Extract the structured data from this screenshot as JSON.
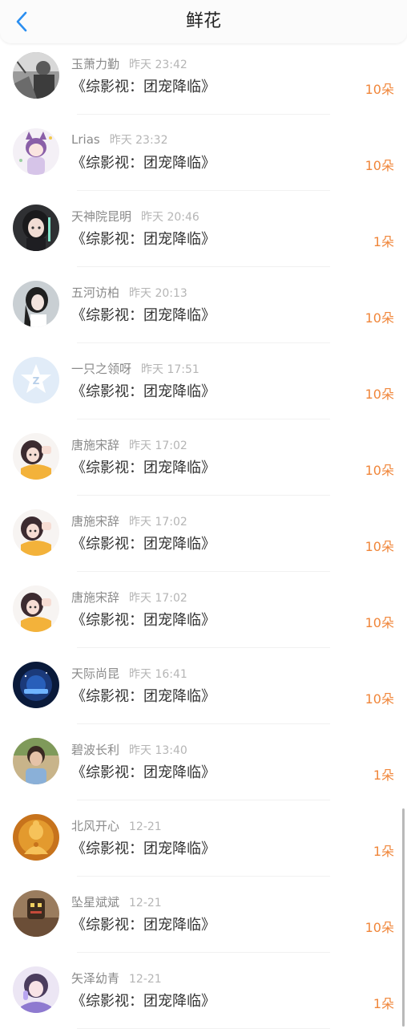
{
  "header": {
    "title": "鲜花",
    "back_icon": "chevron-left-icon",
    "accent_color": "#2a8ef0"
  },
  "flower_color": "#f0863a",
  "records": [
    {
      "name": "玉萧力勤",
      "time": "昨天 23:42",
      "book": "《综影视：团宠降临》",
      "flowers": "10朵",
      "avatar": "avatar-grayscale-photo"
    },
    {
      "name": "Lrias",
      "time": "昨天 23:32",
      "book": "《综影视：团宠降临》",
      "flowers": "10朵",
      "avatar": "avatar-cat-girl"
    },
    {
      "name": "天神院昆明",
      "time": "昨天 20:46",
      "book": "《综影视：团宠降临》",
      "flowers": "1朵",
      "avatar": "avatar-dark-girl"
    },
    {
      "name": "五河访柏",
      "time": "昨天 20:13",
      "book": "《综影视：团宠降临》",
      "flowers": "10朵",
      "avatar": "avatar-long-hair"
    },
    {
      "name": "一只之领呀",
      "time": "昨天 17:51",
      "book": "《综影视：团宠降临》",
      "flowers": "10朵",
      "avatar": "avatar-default-z"
    },
    {
      "name": "唐施宋辞",
      "time": "昨天 17:02",
      "book": "《综影视：团宠降临》",
      "flowers": "10朵",
      "avatar": "avatar-girl-yellow"
    },
    {
      "name": "唐施宋辞",
      "time": "昨天 17:02",
      "book": "《综影视：团宠降临》",
      "flowers": "10朵",
      "avatar": "avatar-girl-yellow"
    },
    {
      "name": "唐施宋辞",
      "time": "昨天 17:02",
      "book": "《综影视：团宠降临》",
      "flowers": "10朵",
      "avatar": "avatar-girl-yellow"
    },
    {
      "name": "天际尚昆",
      "time": "昨天 16:41",
      "book": "《综影视：团宠降临》",
      "flowers": "10朵",
      "avatar": "avatar-blue-logo"
    },
    {
      "name": "碧波长利",
      "time": "昨天 13:40",
      "book": "《综影视：团宠降临》",
      "flowers": "1朵",
      "avatar": "avatar-boy-tree"
    },
    {
      "name": "北风开心",
      "time": "12-21",
      "book": "《综影视：团宠降临》",
      "flowers": "1朵",
      "avatar": "avatar-golden-buddha"
    },
    {
      "name": "坠星斌斌",
      "time": "12-21",
      "book": "《综影视：团宠降临》",
      "flowers": "10朵",
      "avatar": "avatar-brown-figure"
    },
    {
      "name": "矢泽幼青",
      "time": "12-21",
      "book": "《综影视：团宠降临》",
      "flowers": "1朵",
      "avatar": "avatar-purple-girl"
    }
  ]
}
